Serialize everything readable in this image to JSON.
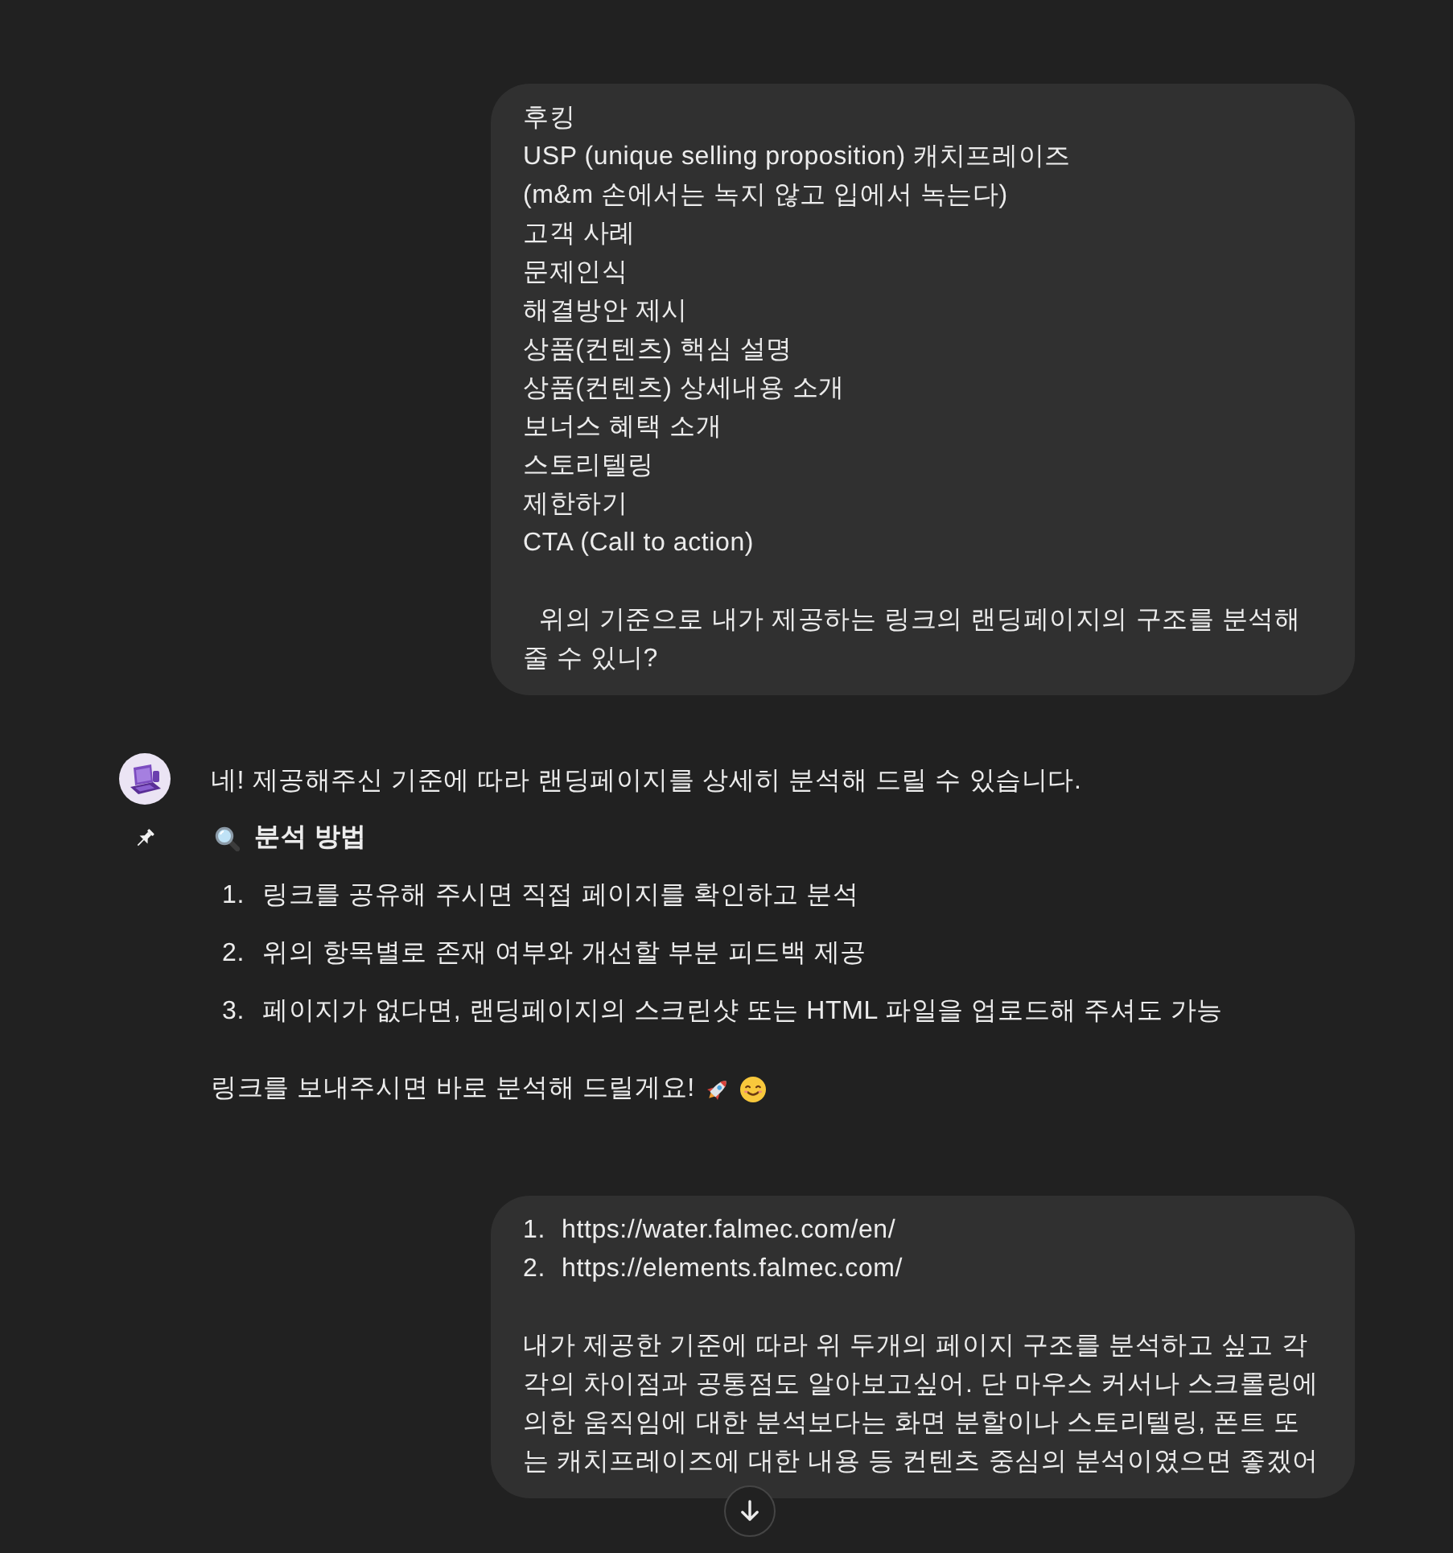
{
  "user_message_1": {
    "lines": [
      "후킹",
      "USP (unique selling proposition) 캐치프레이즈",
      "(m&m 손에서는 녹지 않고 입에서 녹는다)",
      "고객 사례",
      "문제인식",
      "해결방안 제시",
      "상품(컨텐츠) 핵심 설명",
      "상품(컨텐츠) 상세내용 소개",
      "보너스 혜택 소개",
      "스토리텔링",
      "제한하기",
      "CTA (Call to action)"
    ],
    "text": "위의 기준으로 내가 제공하는 링크의 랜딩페이지의 구조를 분석해 줄 수 있니?"
  },
  "assistant_message": {
    "intro": "네! 제공해주신 기준에 따라 랜딩페이지를 상세히 분석해 드릴 수 있습니다.",
    "heading": "분석 방법",
    "steps": [
      {
        "number": "1.",
        "text": "링크를 공유해 주시면 직접 페이지를 확인하고 분석"
      },
      {
        "number": "2.",
        "text": "위의 항목별로 존재 여부와 개선할 부분 피드백 제공"
      },
      {
        "number": "3.",
        "text": "페이지가 없다면, 랜딩페이지의 스크린샷 또는 HTML 파일을 업로드해 주셔도 가능"
      }
    ],
    "closing": "링크를 보내주시면 바로 분석해 드릴게요!"
  },
  "user_message_2": {
    "links": [
      {
        "number": "1.",
        "text": "https://water.falmec.com/en/"
      },
      {
        "number": "2.",
        "text": "https://elements.falmec.com/"
      }
    ],
    "text": "내가 제공한 기준에 따라 위 두개의 페이지 구조를 분석하고 싶고 각각의 차이점과 공통점도 알아보고싶어. 단 마우스 커서나 스크롤링에 의한 움직임에 대한 분석보다는 화면 분할이나 스토리텔링, 폰트 또는 캐치프레이즈에 대한 내용 등 컨텐츠 중심의 분석이였으면 좋겠어"
  }
}
